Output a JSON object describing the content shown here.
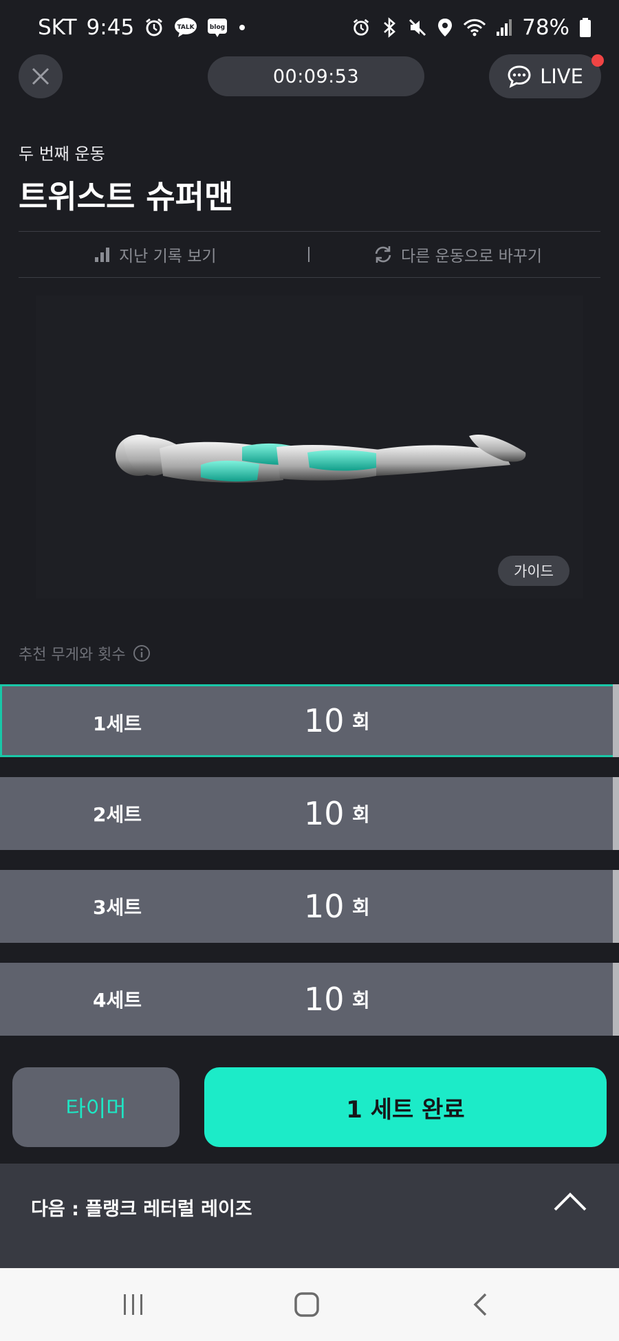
{
  "status_bar": {
    "carrier": "SKT",
    "time": "9:45",
    "talk_badge": "TALK",
    "blog_badge": "blog",
    "battery": "78%",
    "icons_left": [
      "alarm-icon",
      "kakaotalk-icon",
      "blog-icon",
      "dot-icon"
    ],
    "icons_right": [
      "alarm-icon",
      "bluetooth-icon",
      "mute-icon",
      "location-icon",
      "wifi-icon",
      "signal-icon",
      "battery-icon"
    ]
  },
  "header": {
    "elapsed_time": "00:09:53",
    "live_label": "LIVE"
  },
  "exercise": {
    "order_label": "두 번째 운동",
    "name": "트위스트 슈퍼맨"
  },
  "actions": {
    "history_label": "지난 기록 보기",
    "separator": "|",
    "swap_label": "다른 운동으로 바꾸기"
  },
  "figure": {
    "guide_label": "가이드"
  },
  "recommendation": {
    "label": "추천 무게와 횟수"
  },
  "sets": [
    {
      "label": "1세트",
      "count": "10",
      "unit": "회",
      "active": true
    },
    {
      "label": "2세트",
      "count": "10",
      "unit": "회",
      "active": false
    },
    {
      "label": "3세트",
      "count": "10",
      "unit": "회",
      "active": false
    },
    {
      "label": "4세트",
      "count": "10",
      "unit": "회",
      "active": false
    }
  ],
  "buttons": {
    "timer_label": "타이머",
    "complete_label": "1 세트 완료"
  },
  "next": {
    "label": "다음 : 플랭크 레터럴 레이즈"
  },
  "colors": {
    "background": "#1c1d22",
    "accent": "#1cebc8",
    "row": "#5f626d",
    "live_dot": "#f04444"
  }
}
